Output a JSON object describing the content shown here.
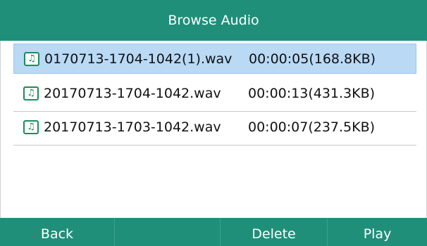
{
  "title": "Browse Audio",
  "files": [
    {
      "name": "0170713-1704-1042(1).wav",
      "info": "00:00:05(168.8KB)",
      "selected": true
    },
    {
      "name": "20170713-1704-1042.wav",
      "info": "00:00:13(431.3KB)",
      "selected": false
    },
    {
      "name": "20170713-1703-1042.wav",
      "info": "00:00:07(237.5KB)",
      "selected": false
    }
  ],
  "softkeys": [
    "Back",
    "",
    "Delete",
    "Play"
  ],
  "colors": {
    "accent": "#1f8f7a",
    "selection": "#b9d9f5",
    "icon": "#1e8a5c"
  },
  "icons": {
    "file": "music-note-icon"
  }
}
